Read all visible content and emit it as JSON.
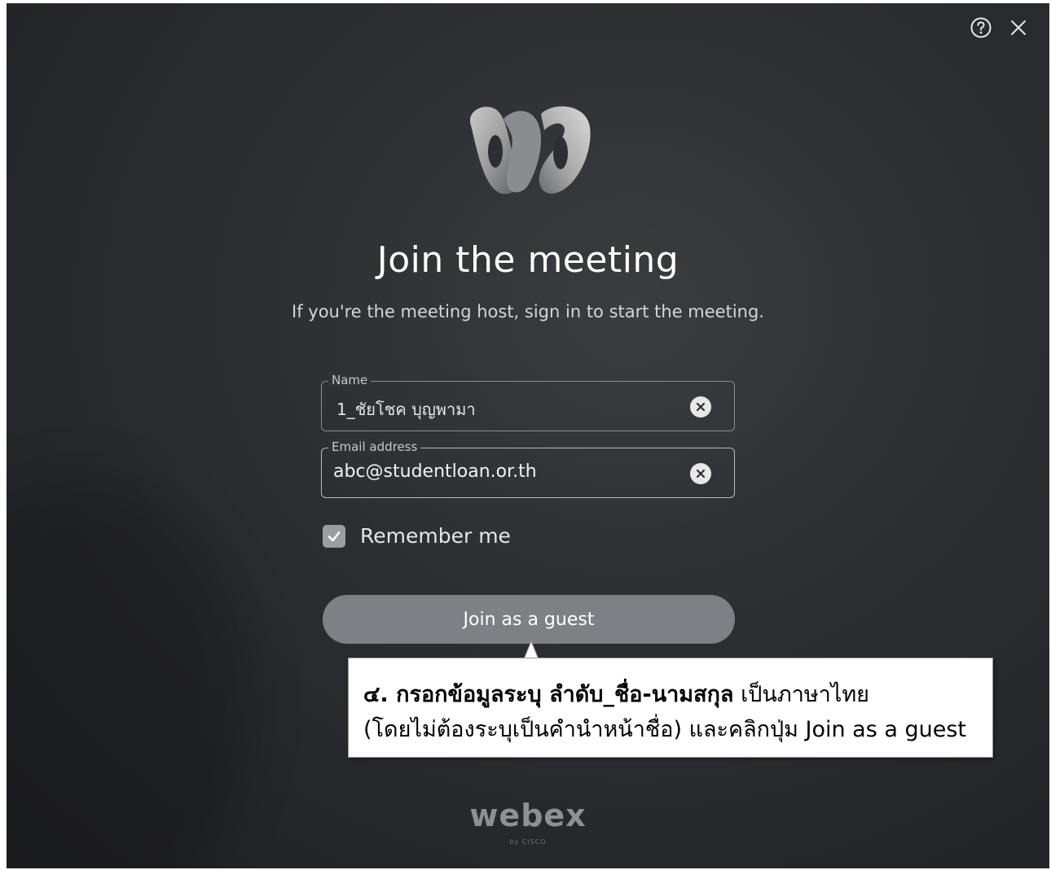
{
  "window": {
    "help_icon": "help-circle-icon",
    "close_icon": "close-icon"
  },
  "header": {
    "logo_icon": "webex-logo-icon",
    "title": "Join the meeting",
    "subtitle": "If you're the meeting host, sign in to start the meeting."
  },
  "form": {
    "name_label": "Name",
    "name_value": "1_ชัยโชค บุญพามา",
    "email_label": "Email address",
    "email_value": "abc@studentloan.or.th",
    "clear_icon": "clear-icon",
    "remember_label": "Remember me",
    "remember_checked": true,
    "join_label": "Join as a guest"
  },
  "callout": {
    "line1_bold": "๔. กรอกข้อมูลระบุ ลำดับ_ชื่อ-นามสกุล",
    "line1_rest": " เป็นภาษาไทย",
    "line2": "(โดยไม่ต้องระบุเป็นคำนำหน้าชื่อ) และคลิกปุ่ม Join as a guest"
  },
  "footer": {
    "brand": "webex",
    "brand_sub": "by CISCO"
  }
}
